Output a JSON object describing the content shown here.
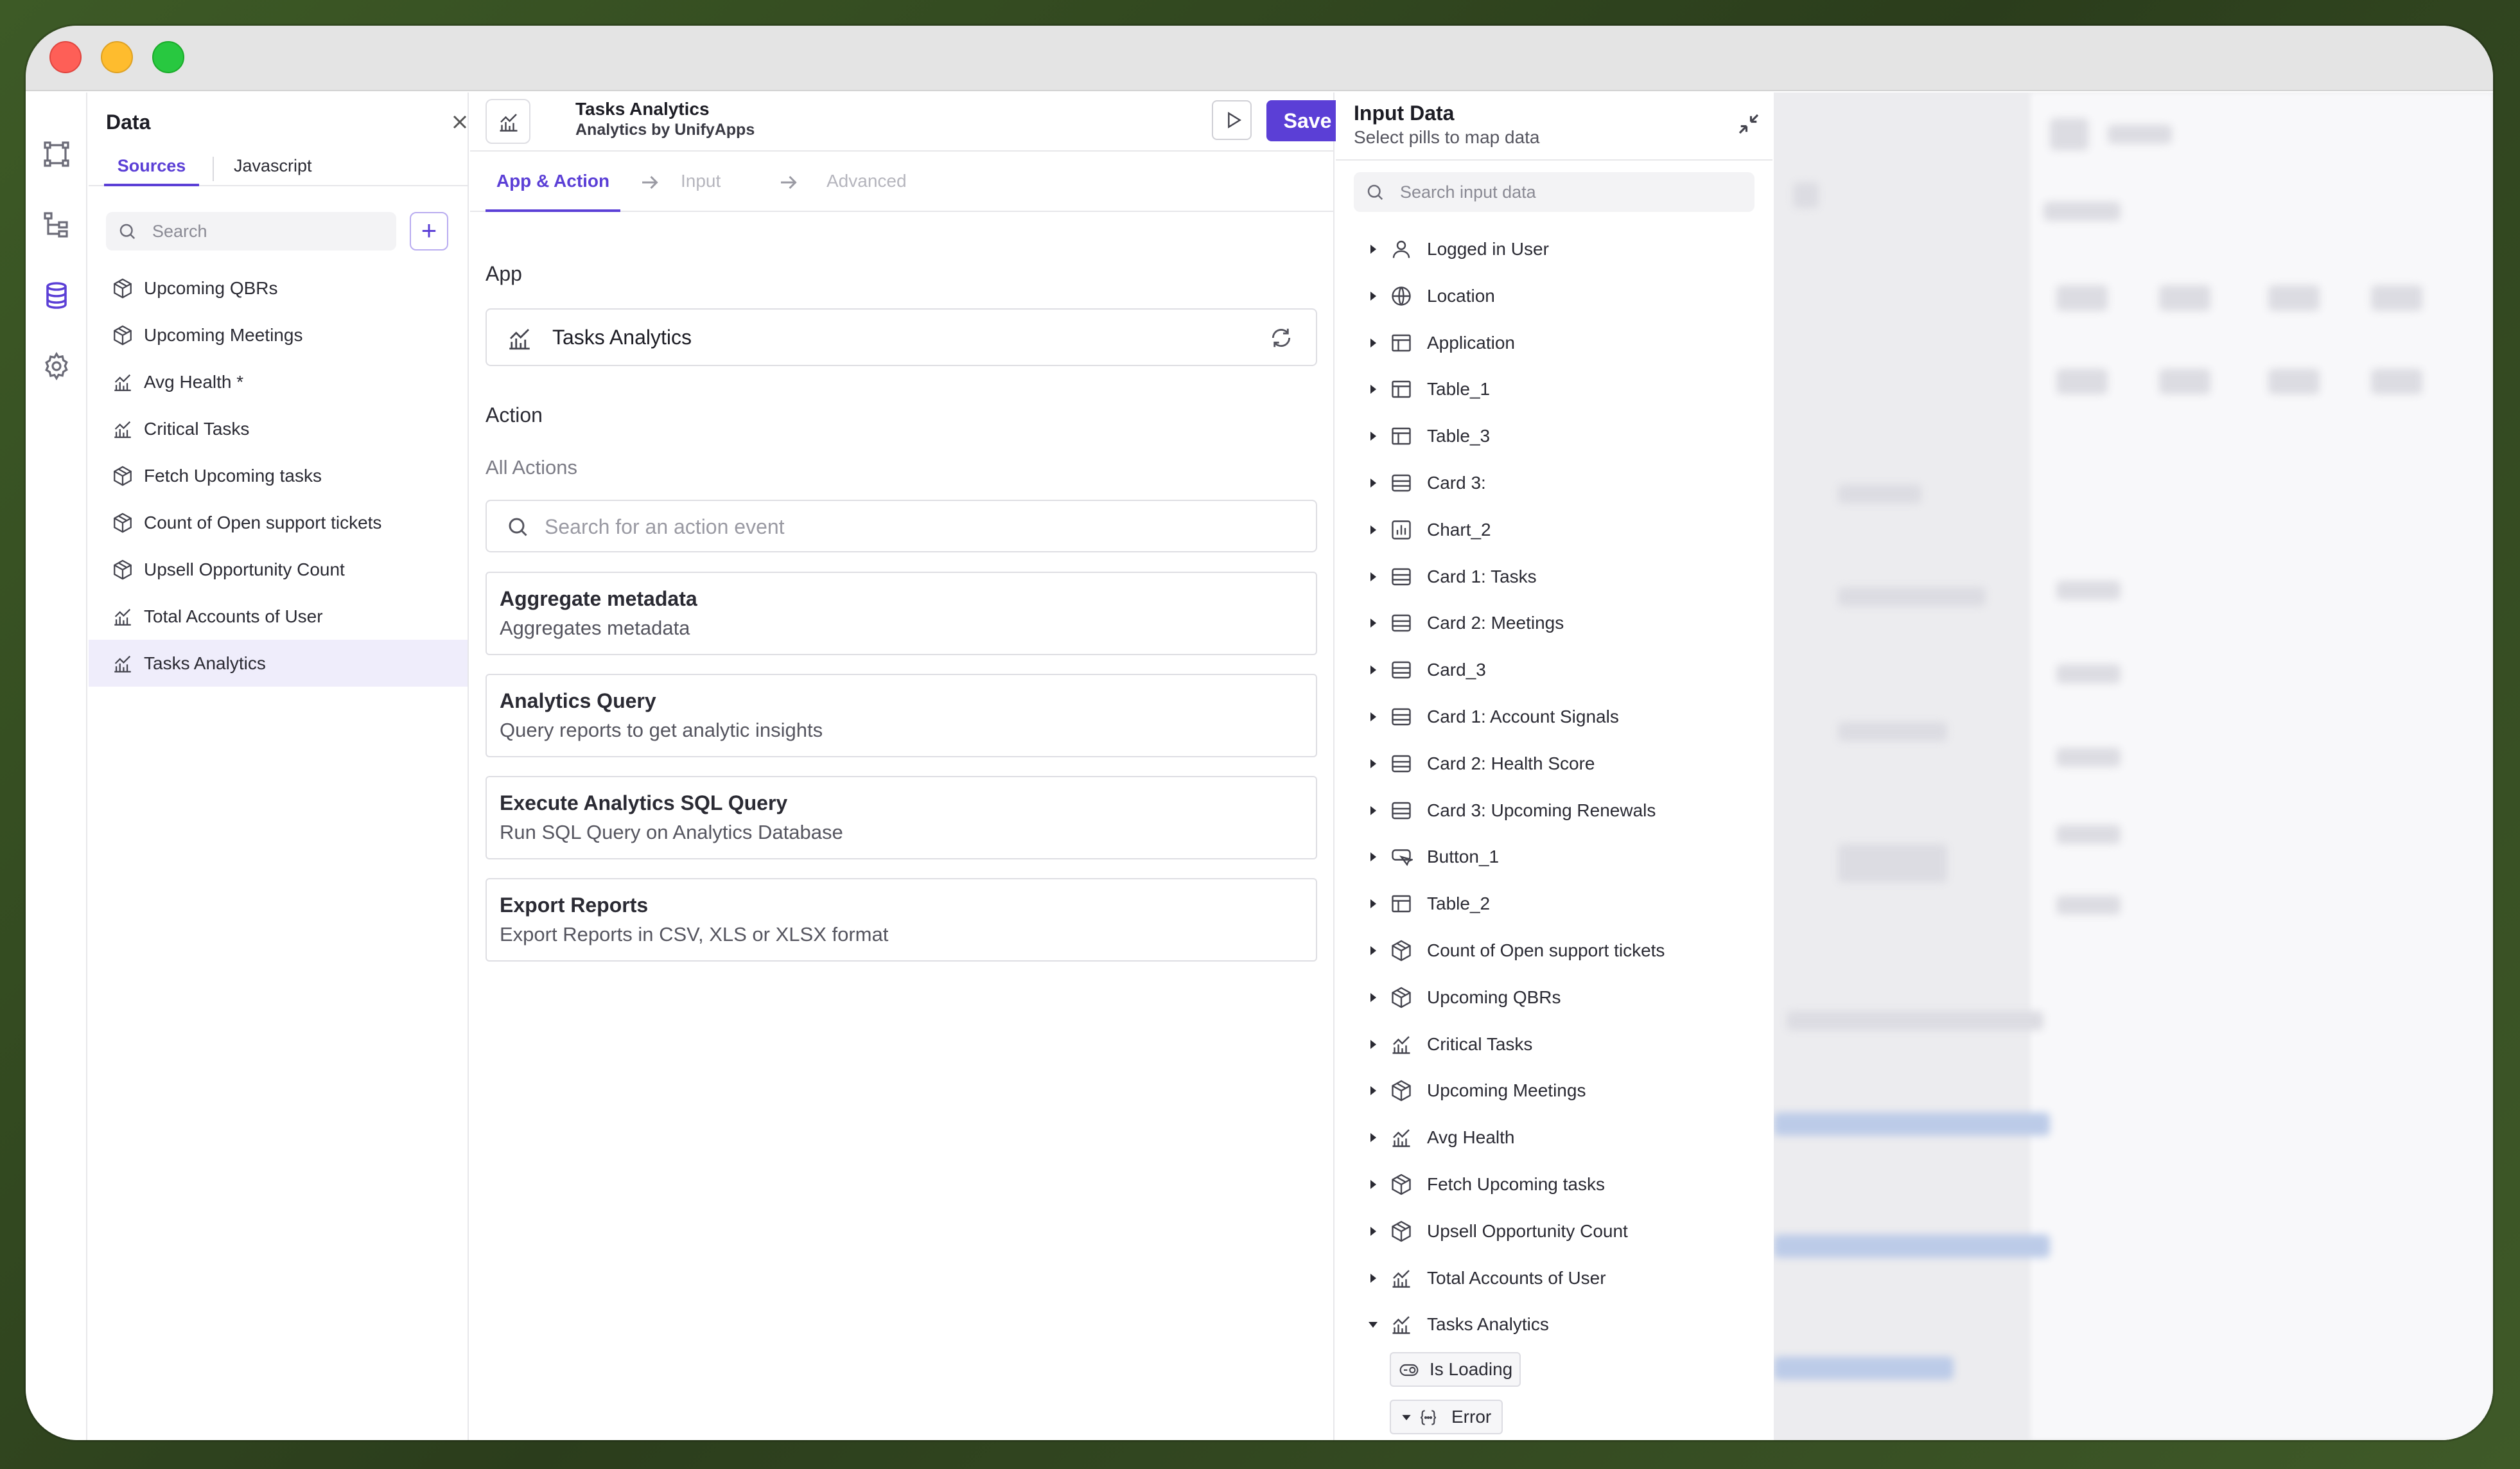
{
  "window": {
    "traffic_lights": [
      "close",
      "minimize",
      "maximize"
    ]
  },
  "rail": {
    "icons": [
      "flow-icon",
      "tree-icon",
      "database-icon",
      "settings-icon"
    ],
    "active_icon": "database-icon",
    "accent_color": "#5b3fd6"
  },
  "data_panel": {
    "title": "Data",
    "tabs": [
      {
        "label": "Sources",
        "active": true
      },
      {
        "label": "Javascript",
        "active": false
      }
    ],
    "search_placeholder": "Search",
    "add_label": "+",
    "items": [
      {
        "label": "Upcoming QBRs",
        "icon": "cube-icon"
      },
      {
        "label": "Upcoming Meetings",
        "icon": "cube-icon"
      },
      {
        "label": "Avg Health *",
        "icon": "analytics-icon"
      },
      {
        "label": "Critical Tasks",
        "icon": "analytics-icon"
      },
      {
        "label": "Fetch Upcoming tasks",
        "icon": "cube-icon"
      },
      {
        "label": "Count of Open support tickets",
        "icon": "cube-icon"
      },
      {
        "label": "Upsell Opportunity Count",
        "icon": "cube-icon"
      },
      {
        "label": "Total Accounts of User",
        "icon": "analytics-icon"
      },
      {
        "label": "Tasks Analytics",
        "icon": "analytics-icon",
        "selected": true
      }
    ]
  },
  "center": {
    "header": {
      "title": "Tasks Analytics",
      "subtitle": "Analytics by UnifyApps",
      "save_label": "Save"
    },
    "steps": [
      {
        "label": "App & Action",
        "active": true
      },
      {
        "label": "Input",
        "active": false
      },
      {
        "label": "Advanced",
        "active": false
      }
    ],
    "app_label": "App",
    "app_name": "Tasks Analytics",
    "action_label": "Action",
    "all_actions_label": "All Actions",
    "action_search_placeholder": "Search for an action event",
    "actions": [
      {
        "title": "Aggregate metadata",
        "description": "Aggregates metadata"
      },
      {
        "title": "Analytics Query",
        "description": "Query reports to get analytic insights"
      },
      {
        "title": "Execute Analytics SQL Query",
        "description": "Run SQL Query on Analytics Database"
      },
      {
        "title": "Export Reports",
        "description": "Export Reports in CSV, XLS or XLSX format"
      }
    ]
  },
  "input_panel": {
    "title": "Input Data",
    "subtitle": "Select pills to map data",
    "search_placeholder": "Search input data",
    "items": [
      {
        "label": "Logged in User",
        "icon": "user-icon"
      },
      {
        "label": "Location",
        "icon": "globe-icon"
      },
      {
        "label": "Application",
        "icon": "table-icon"
      },
      {
        "label": "Table_1",
        "icon": "table-icon"
      },
      {
        "label": "Table_3",
        "icon": "table-icon"
      },
      {
        "label": "Card 3:",
        "icon": "card-icon"
      },
      {
        "label": "Chart_2",
        "icon": "chart-icon"
      },
      {
        "label": "Card 1: Tasks",
        "icon": "card-icon"
      },
      {
        "label": "Card 2: Meetings",
        "icon": "card-icon"
      },
      {
        "label": "Card_3",
        "icon": "card-icon"
      },
      {
        "label": "Card 1: Account Signals",
        "icon": "card-icon"
      },
      {
        "label": "Card 2: Health Score",
        "icon": "card-icon"
      },
      {
        "label": "Card 3: Upcoming Renewals",
        "icon": "card-icon"
      },
      {
        "label": "Button_1",
        "icon": "button-icon"
      },
      {
        "label": "Table_2",
        "icon": "table-icon"
      },
      {
        "label": "Count of Open support tickets",
        "icon": "cube-icon"
      },
      {
        "label": "Upcoming QBRs",
        "icon": "cube-icon"
      },
      {
        "label": "Critical Tasks",
        "icon": "analytics-icon"
      },
      {
        "label": "Upcoming Meetings",
        "icon": "cube-icon"
      },
      {
        "label": "Avg Health",
        "icon": "analytics-icon"
      },
      {
        "label": "Fetch Upcoming tasks",
        "icon": "cube-icon"
      },
      {
        "label": "Upsell Opportunity Count",
        "icon": "cube-icon"
      },
      {
        "label": "Total Accounts of User",
        "icon": "analytics-icon"
      },
      {
        "label": "Tasks Analytics",
        "icon": "analytics-icon",
        "expanded": true
      }
    ],
    "pills": [
      {
        "label": "Is Loading",
        "icon": "toggle-icon"
      },
      {
        "label": "Error",
        "icon": "object-icon",
        "expanded": true
      }
    ]
  }
}
